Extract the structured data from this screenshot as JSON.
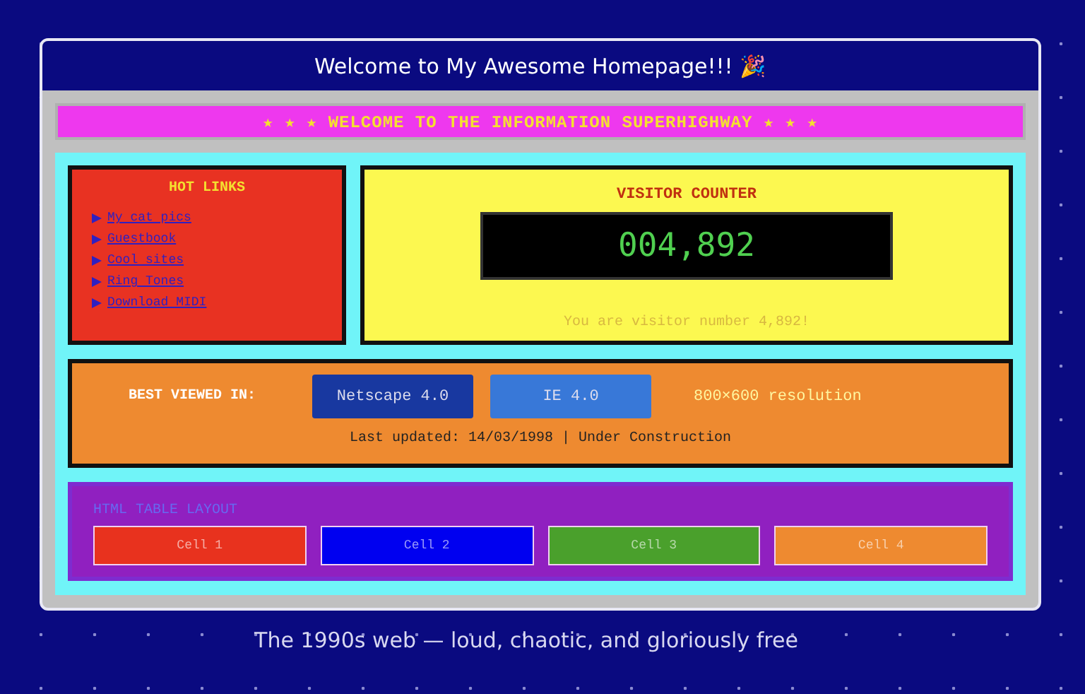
{
  "window": {
    "title": "Welcome to My Awesome Homepage!!! 🎉"
  },
  "banner": "★ ★ ★ WELCOME TO THE INFORMATION SUPERHIGHWAY ★ ★ ★",
  "hot_links": {
    "title": "HOT LINKS",
    "items": [
      {
        "label": "My cat pics"
      },
      {
        "label": "Guestbook"
      },
      {
        "label": "Cool sites"
      },
      {
        "label": "Ring Tones"
      },
      {
        "label": "Download MIDI"
      }
    ]
  },
  "visitor_counter": {
    "title": "VISITOR COUNTER",
    "count": "004,892",
    "message": "You are visitor number 4,892!"
  },
  "best_viewed": {
    "label": "BEST VIEWED IN:",
    "browsers": [
      {
        "label": "Netscape 4.0",
        "selected": true
      },
      {
        "label": "IE 4.0",
        "selected": false
      }
    ],
    "resolution": "800×600 resolution",
    "updated": "Last updated: 14/03/1998 | Under Construction"
  },
  "table_layout": {
    "title": "HTML TABLE LAYOUT",
    "cells": [
      {
        "label": "Cell 1",
        "color": "#e8321e"
      },
      {
        "label": "Cell 2",
        "color": "#0000f0"
      },
      {
        "label": "Cell 3",
        "color": "#4aa02c"
      },
      {
        "label": "Cell 4",
        "color": "#ee8a30"
      }
    ]
  },
  "caption": "The 1990s web — loud, chaotic, and gloriously free"
}
